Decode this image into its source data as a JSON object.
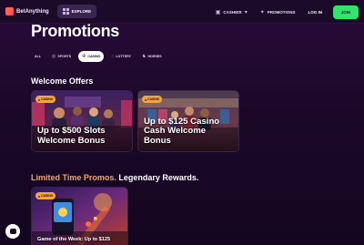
{
  "brand": {
    "name": "BetAnything"
  },
  "nav": {
    "explore_label": "EXPLORE",
    "cashier_label": "CASHIER",
    "promotions_label": "PROMOTIONS",
    "login_label": "LOG IN",
    "join_label": "JOIN"
  },
  "page": {
    "title": "Promotions"
  },
  "filters": [
    {
      "label": "ALL",
      "icon": "",
      "active": false
    },
    {
      "label": "SPORTS",
      "icon": "sports-icon",
      "active": false
    },
    {
      "label": "CASINO",
      "icon": "casino-icon",
      "active": true
    },
    {
      "label": "LOTTERY",
      "icon": "lottery-icon",
      "active": false
    },
    {
      "label": "HORSES",
      "icon": "horse-icon",
      "active": false
    }
  ],
  "sections": {
    "welcome": {
      "title": "Welcome Offers"
    },
    "limited": {
      "title_accent": "Limited Time Promos.",
      "title_rest": " Legendary Rewards."
    }
  },
  "cards": [
    {
      "badge": "CASINO",
      "caption": "Up to $500 Slots Welcome Bonus"
    },
    {
      "badge": "CASINO",
      "caption": "Up to $125 Casino Cash Welcome Bonus"
    },
    {
      "badge": "CASINO",
      "caption": "Game of the Week: Up to $125"
    }
  ],
  "colors": {
    "accent_orange": "#ffa640",
    "join_green": "#2fe56b",
    "badge_gold": "#f3a63c"
  }
}
